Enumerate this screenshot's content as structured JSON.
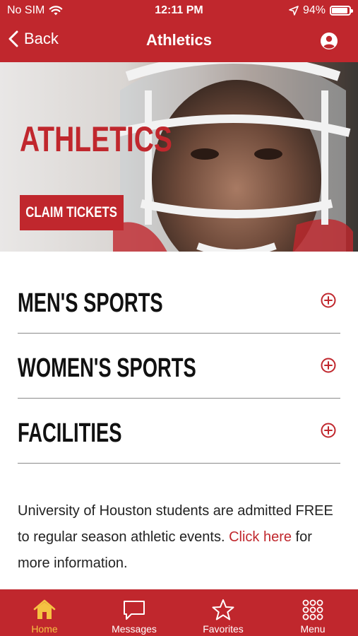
{
  "status": {
    "carrier": "No SIM",
    "time": "12:11 PM",
    "battery": "94%"
  },
  "nav": {
    "back_label": "Back",
    "title": "Athletics"
  },
  "hero": {
    "title": "ATHLETICS",
    "claim_label": "CLAIM TICKETS"
  },
  "accordion": [
    {
      "label": "MEN'S SPORTS"
    },
    {
      "label": "WOMEN'S SPORTS"
    },
    {
      "label": "FACILITIES"
    }
  ],
  "info": {
    "text_before": "University of Houston students are admitted FREE to regular season athletic events. ",
    "link": "Click here",
    "text_after": " for more information."
  },
  "tabs": [
    {
      "label": "Home",
      "icon": "home-icon",
      "active": true
    },
    {
      "label": "Messages",
      "icon": "chat-bubble-icon",
      "active": false
    },
    {
      "label": "Favorites",
      "icon": "star-icon",
      "active": false
    },
    {
      "label": "Menu",
      "icon": "grid-dots-icon",
      "active": false
    }
  ],
  "colors": {
    "brand_red": "#c0272d",
    "active_tab": "#f5c242"
  }
}
